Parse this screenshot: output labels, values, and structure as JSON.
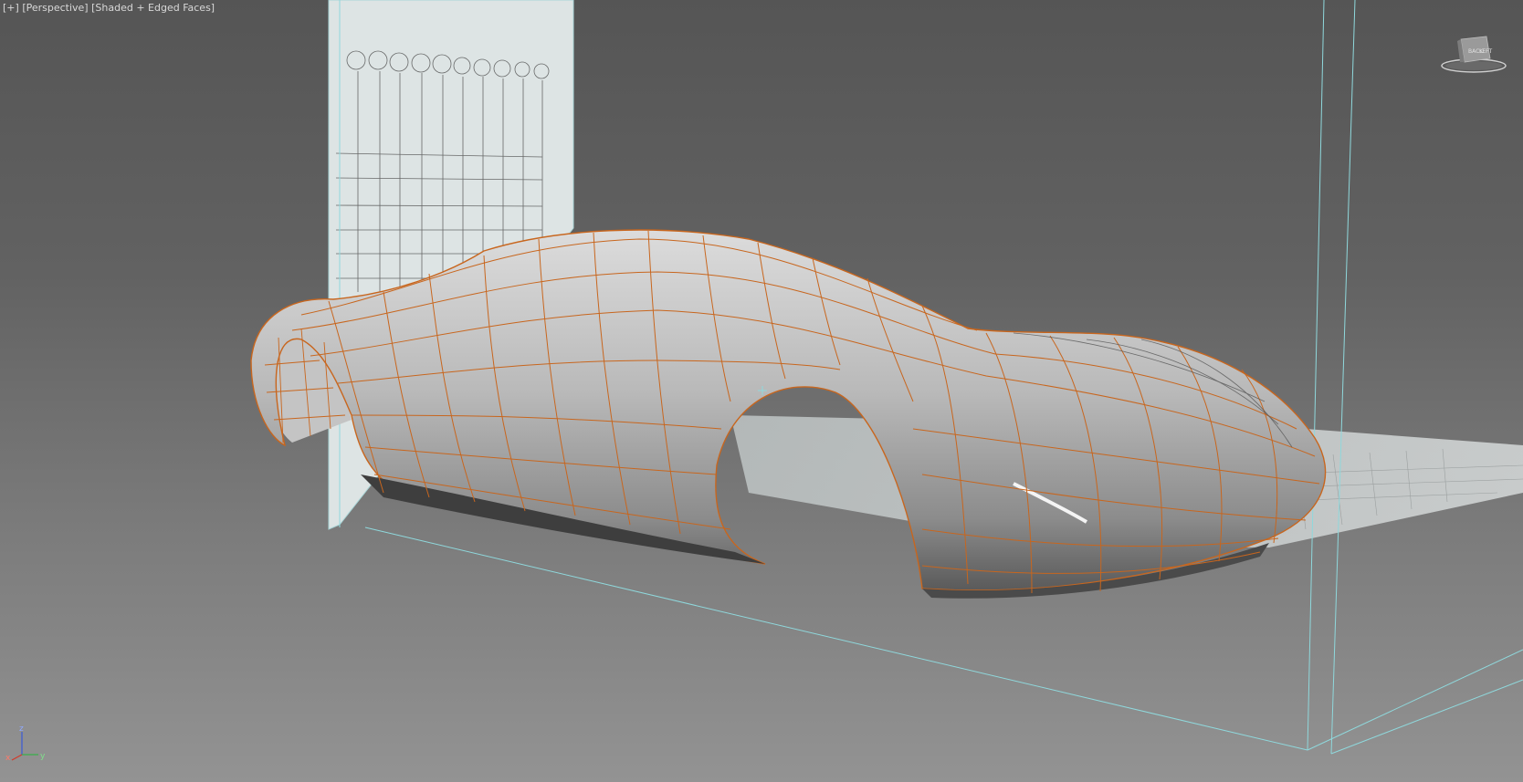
{
  "viewport": {
    "menu_label": "[+]",
    "view_label": "[Perspective]",
    "shading_label": "[Shaded + Edged Faces]"
  },
  "viewcube": {
    "left_face": "BACK",
    "right_face": "LEFT"
  },
  "axis_tripod": {
    "x": "x",
    "y": "y",
    "z": "z"
  },
  "colors": {
    "wire": "#c8661e",
    "selection_box": "#8fd8dc",
    "axis_x": "#d23a2a",
    "axis_y": "#3ab04a",
    "axis_z": "#3a5ad8"
  }
}
